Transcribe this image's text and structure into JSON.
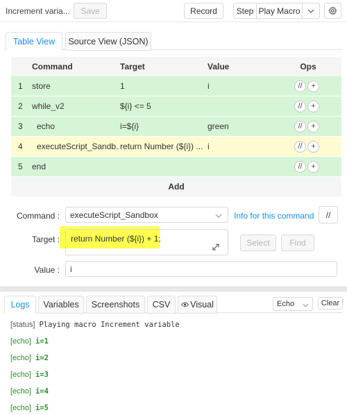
{
  "toolbar": {
    "macro_name": "Increment varia...",
    "save_label": "Save",
    "record_label": "Record",
    "step_label": "Step",
    "play_label": "Play Macro"
  },
  "editor": {
    "tabs": [
      {
        "label": "Table View",
        "active": true
      },
      {
        "label": "Source View (JSON)",
        "active": false
      }
    ],
    "columns": {
      "command": "Command",
      "target": "Target",
      "value": "Value",
      "ops": "Ops"
    },
    "rows": [
      {
        "index": "1",
        "command": "store",
        "target": "1",
        "value": "i",
        "color": "green"
      },
      {
        "index": "2",
        "command": "while_v2",
        "target": "${i} <= 5",
        "value": "",
        "color": "green"
      },
      {
        "index": "3",
        "command": "echo",
        "target": "i=${i}",
        "value": "green",
        "color": "green"
      },
      {
        "index": "4",
        "command": "executeScript_Sandb...",
        "target": "return Number (${i}) ...",
        "value": "i",
        "color": "yellow"
      },
      {
        "index": "5",
        "command": "end",
        "target": "",
        "value": "",
        "color": "green"
      }
    ],
    "add_label": "Add",
    "ops_comment": "//",
    "ops_add": "+"
  },
  "form": {
    "command_label": "Command :",
    "command_value": "executeScript_Sandbox",
    "info_link": "Info for this command",
    "comment_label": "//",
    "target_label": "Target :",
    "target_value": "return Number (${i}) + 1;",
    "select_label": "Select",
    "find_label": "Find",
    "value_label": "Value :",
    "value_value": "i"
  },
  "logs": {
    "tabs": [
      {
        "label": "Logs",
        "active": true
      },
      {
        "label": "Variables",
        "active": false
      },
      {
        "label": "Screenshots",
        "active": false
      },
      {
        "label": "CSV",
        "active": false
      },
      {
        "label": "Visual",
        "active": false
      }
    ],
    "filter_value": "Echo",
    "clear_label": "Clear",
    "entries": [
      {
        "tag": "[status]",
        "msg": "Playing macro Increment variable",
        "type": "status"
      },
      {
        "tag": "[echo]",
        "msg": "i=1",
        "type": "echo"
      },
      {
        "tag": "[echo]",
        "msg": "i=2",
        "type": "echo"
      },
      {
        "tag": "[echo]",
        "msg": "i=3",
        "type": "echo"
      },
      {
        "tag": "[echo]",
        "msg": "i=4",
        "type": "echo"
      },
      {
        "tag": "[echo]",
        "msg": "i=5",
        "type": "echo"
      }
    ]
  },
  "colors": {
    "accent": "#1890ff",
    "row_green": "#d6f5d6",
    "row_yellow": "#fffbd1",
    "highlight": "#ffff33",
    "echo_text": "#2e8b2e"
  },
  "icons": {
    "play_caret": "chevron-down-icon",
    "settings": "gear-icon",
    "expand": "expand-icon",
    "visual_tab": "eye-icon"
  }
}
